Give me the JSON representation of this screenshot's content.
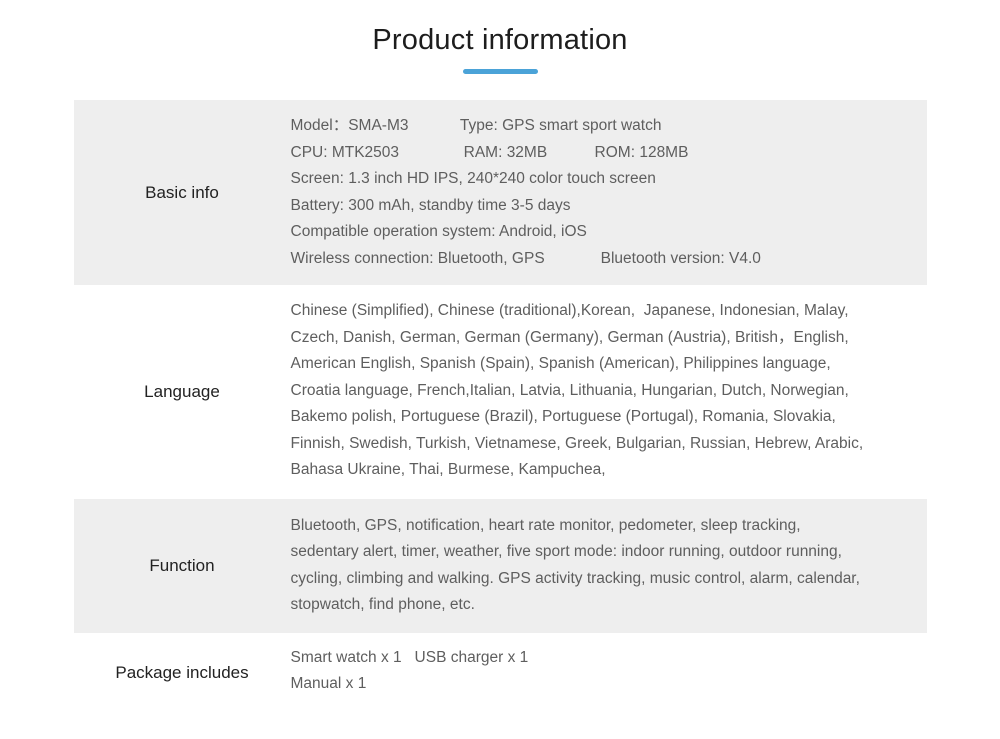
{
  "header": {
    "title": "Product information",
    "accent_color": "#4ba3d8"
  },
  "theme": {
    "shaded_row_bg": "#eeeeee",
    "plain_row_bg": "#ffffff",
    "body_text_color": "#5e5e5e",
    "label_text_color": "#222222"
  },
  "table": {
    "rows": [
      {
        "label": "Basic info",
        "shaded": true,
        "lines": [
          "Model：SMA-M3            Type: GPS smart sport watch",
          "CPU: MTK2503               RAM: 32MB           ROM: 128MB",
          "Screen: 1.3 inch HD IPS, 240*240 color touch screen",
          "Battery: 300 mAh, standby time 3-5 days",
          "Compatible operation system: Android, iOS",
          "Wireless connection: Bluetooth, GPS             Bluetooth version: V4.0"
        ]
      },
      {
        "label": "Language",
        "shaded": false,
        "lines": [
          "Chinese (Simplified), Chinese (traditional),Korean,  Japanese, Indonesian, Malay,",
          "Czech, Danish, German, German (Germany), German (Austria), British，English,",
          "American English, Spanish (Spain), Spanish (American), Philippines language,",
          "Croatia language, French,Italian, Latvia, Lithuania, Hungarian, Dutch, Norwegian,",
          "Bakemo polish, Portuguese (Brazil), Portuguese (Portugal), Romania, Slovakia,",
          "Finnish, Swedish, Turkish, Vietnamese, Greek, Bulgarian, Russian, Hebrew, Arabic,",
          "Bahasa Ukraine, Thai, Burmese, Kampuchea,"
        ]
      },
      {
        "label": "Function",
        "shaded": true,
        "lines": [
          "Bluetooth, GPS, notification, heart rate monitor, pedometer, sleep tracking,",
          "sedentary alert, timer, weather, five sport mode: indoor running, outdoor running,",
          "cycling, climbing and walking. GPS activity tracking, music control, alarm, calendar,",
          "stopwatch, find phone, etc."
        ]
      },
      {
        "label": "Package includes",
        "shaded": false,
        "lines": [
          "Smart watch x 1   USB charger x 1",
          "Manual x 1"
        ]
      }
    ]
  }
}
